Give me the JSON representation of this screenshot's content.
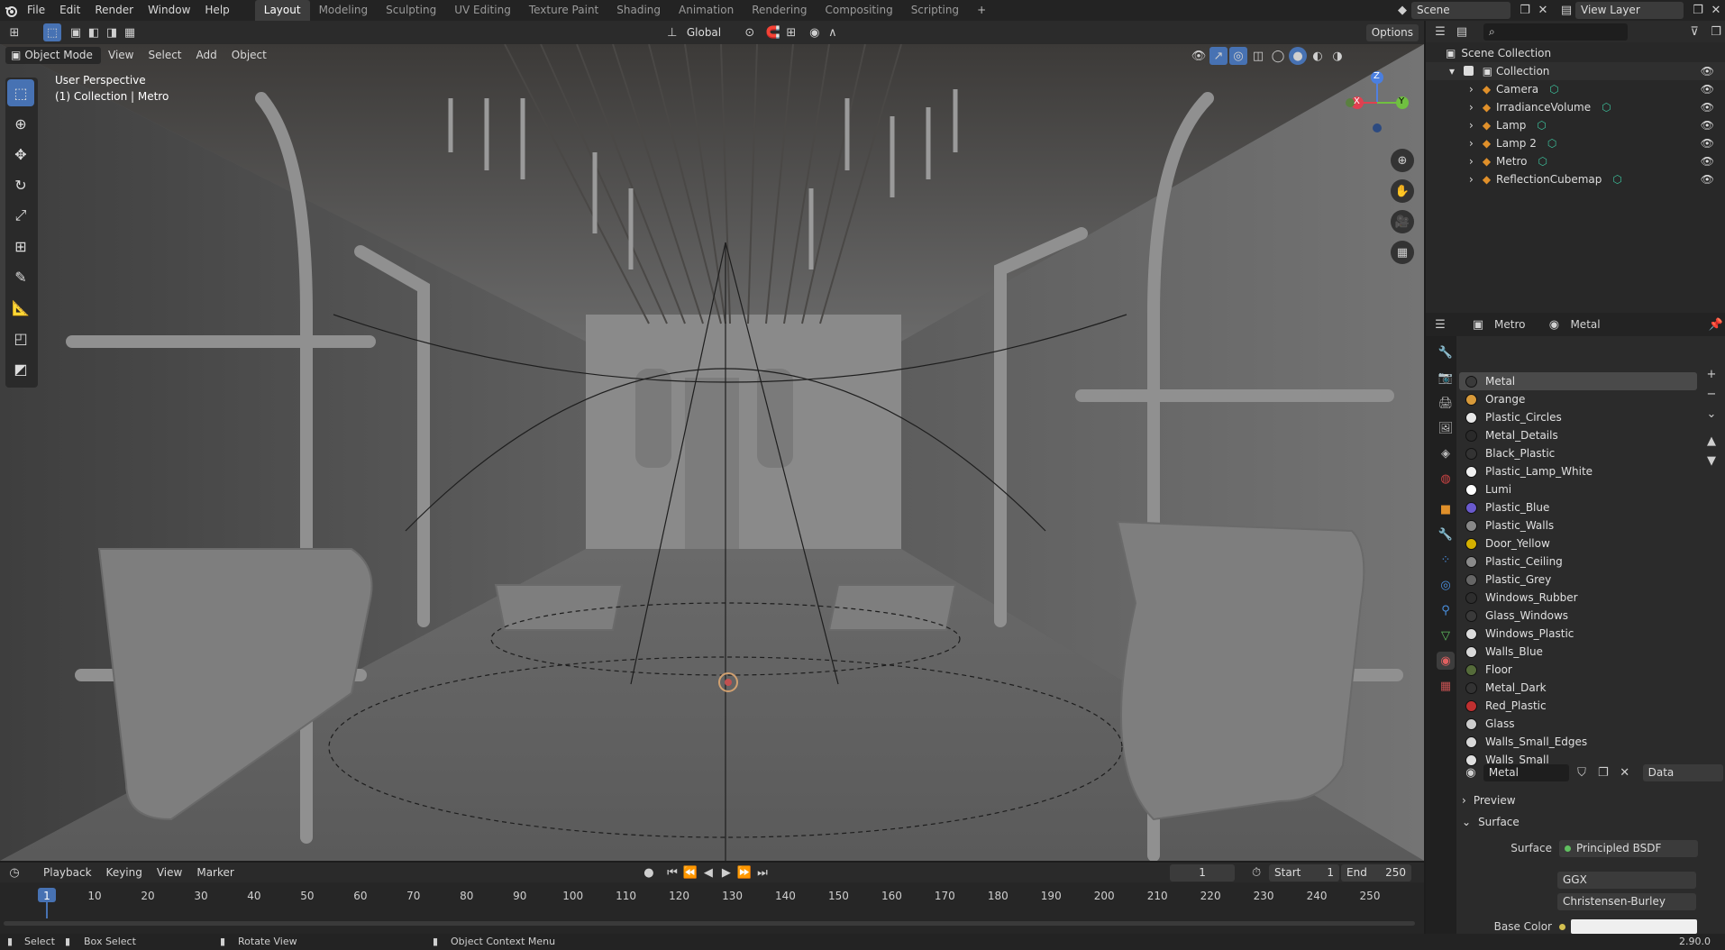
{
  "menubar": {
    "items": [
      "File",
      "Edit",
      "Render",
      "Window",
      "Help"
    ],
    "workspaces": [
      "Layout",
      "Modeling",
      "Sculpting",
      "UV Editing",
      "Texture Paint",
      "Shading",
      "Animation",
      "Rendering",
      "Compositing",
      "Scripting"
    ],
    "active_workspace": "Layout",
    "add_tab": "+",
    "scene": "Scene",
    "view_layer": "View Layer"
  },
  "viewport_header": {
    "mode": "Object Mode",
    "menus": [
      "View",
      "Select",
      "Add",
      "Object"
    ],
    "orientation": "Global",
    "options": "Options"
  },
  "viewport": {
    "perspective": "User Perspective",
    "collection": "(1) Collection | Metro",
    "gizmo": {
      "x": "X",
      "y": "Y",
      "z": "Z"
    }
  },
  "outliner": {
    "root": "Scene Collection",
    "collection": "Collection",
    "items": [
      {
        "name": "Camera",
        "icon": "camera-icon"
      },
      {
        "name": "IrradianceVolume",
        "icon": "light-probe-icon"
      },
      {
        "name": "Lamp",
        "icon": "lamp-icon"
      },
      {
        "name": "Lamp 2",
        "icon": "lamp-icon"
      },
      {
        "name": "Metro",
        "icon": "mesh-icon"
      },
      {
        "name": "ReflectionCubemap",
        "icon": "reflection-probe-icon"
      }
    ]
  },
  "properties": {
    "object": "Metro",
    "material": "Metal",
    "data_label": "Data",
    "slot_name": "Metal",
    "materials": [
      {
        "name": "Metal",
        "color": "#3a3a3a"
      },
      {
        "name": "Orange",
        "color": "#d89a3a"
      },
      {
        "name": "Plastic_Circles",
        "color": "#e8e8e8"
      },
      {
        "name": "Metal_Details",
        "color": "#2a2a2a"
      },
      {
        "name": "Black_Plastic",
        "color": "#333333"
      },
      {
        "name": "Plastic_Lamp_White",
        "color": "#f0f0f0"
      },
      {
        "name": "Lumi",
        "color": "#ffffff"
      },
      {
        "name": "Plastic_Blue",
        "color": "#6a5acd"
      },
      {
        "name": "Plastic_Walls",
        "color": "#888888"
      },
      {
        "name": "Door_Yellow",
        "color": "#d4b000"
      },
      {
        "name": "Plastic_Ceiling",
        "color": "#8a8a8a"
      },
      {
        "name": "Plastic_Grey",
        "color": "#666666"
      },
      {
        "name": "Windows_Rubber",
        "color": "#2e2e2e"
      },
      {
        "name": "Glass_Windows",
        "color": "#3a3a3a"
      },
      {
        "name": "Windows_Plastic",
        "color": "#dcdcdc"
      },
      {
        "name": "Walls_Blue",
        "color": "#d8d8d8"
      },
      {
        "name": "Floor",
        "color": "#556b3a"
      },
      {
        "name": "Metal_Dark",
        "color": "#333333"
      },
      {
        "name": "Red_Plastic",
        "color": "#c03030"
      },
      {
        "name": "Glass",
        "color": "#cccccc"
      },
      {
        "name": "Walls_Small_Edges",
        "color": "#d8d8d8"
      },
      {
        "name": "Walls_Small",
        "color": "#e0e0e0"
      }
    ],
    "panels": {
      "preview": "Preview",
      "surface": "Surface"
    },
    "surface_label": "Surface",
    "surface_value": "Principled BSDF",
    "distribution": "GGX",
    "subsurface": "Christensen-Burley",
    "base_color_label": "Base Color"
  },
  "timeline": {
    "menus": [
      "Playback",
      "Keying",
      "View",
      "Marker"
    ],
    "current_frame": "1",
    "start_label": "Start",
    "start": "1",
    "end_label": "End",
    "end": "250",
    "ticks": [
      "1",
      "10",
      "20",
      "30",
      "40",
      "50",
      "60",
      "70",
      "80",
      "90",
      "100",
      "110",
      "120",
      "130",
      "140",
      "150",
      "160",
      "170",
      "180",
      "190",
      "200",
      "210",
      "220",
      "230",
      "240",
      "250"
    ]
  },
  "statusbar": {
    "select": "Select",
    "box_select": "Box Select",
    "rotate": "Rotate View",
    "context": "Object Context Menu",
    "version": "2.90.0"
  }
}
